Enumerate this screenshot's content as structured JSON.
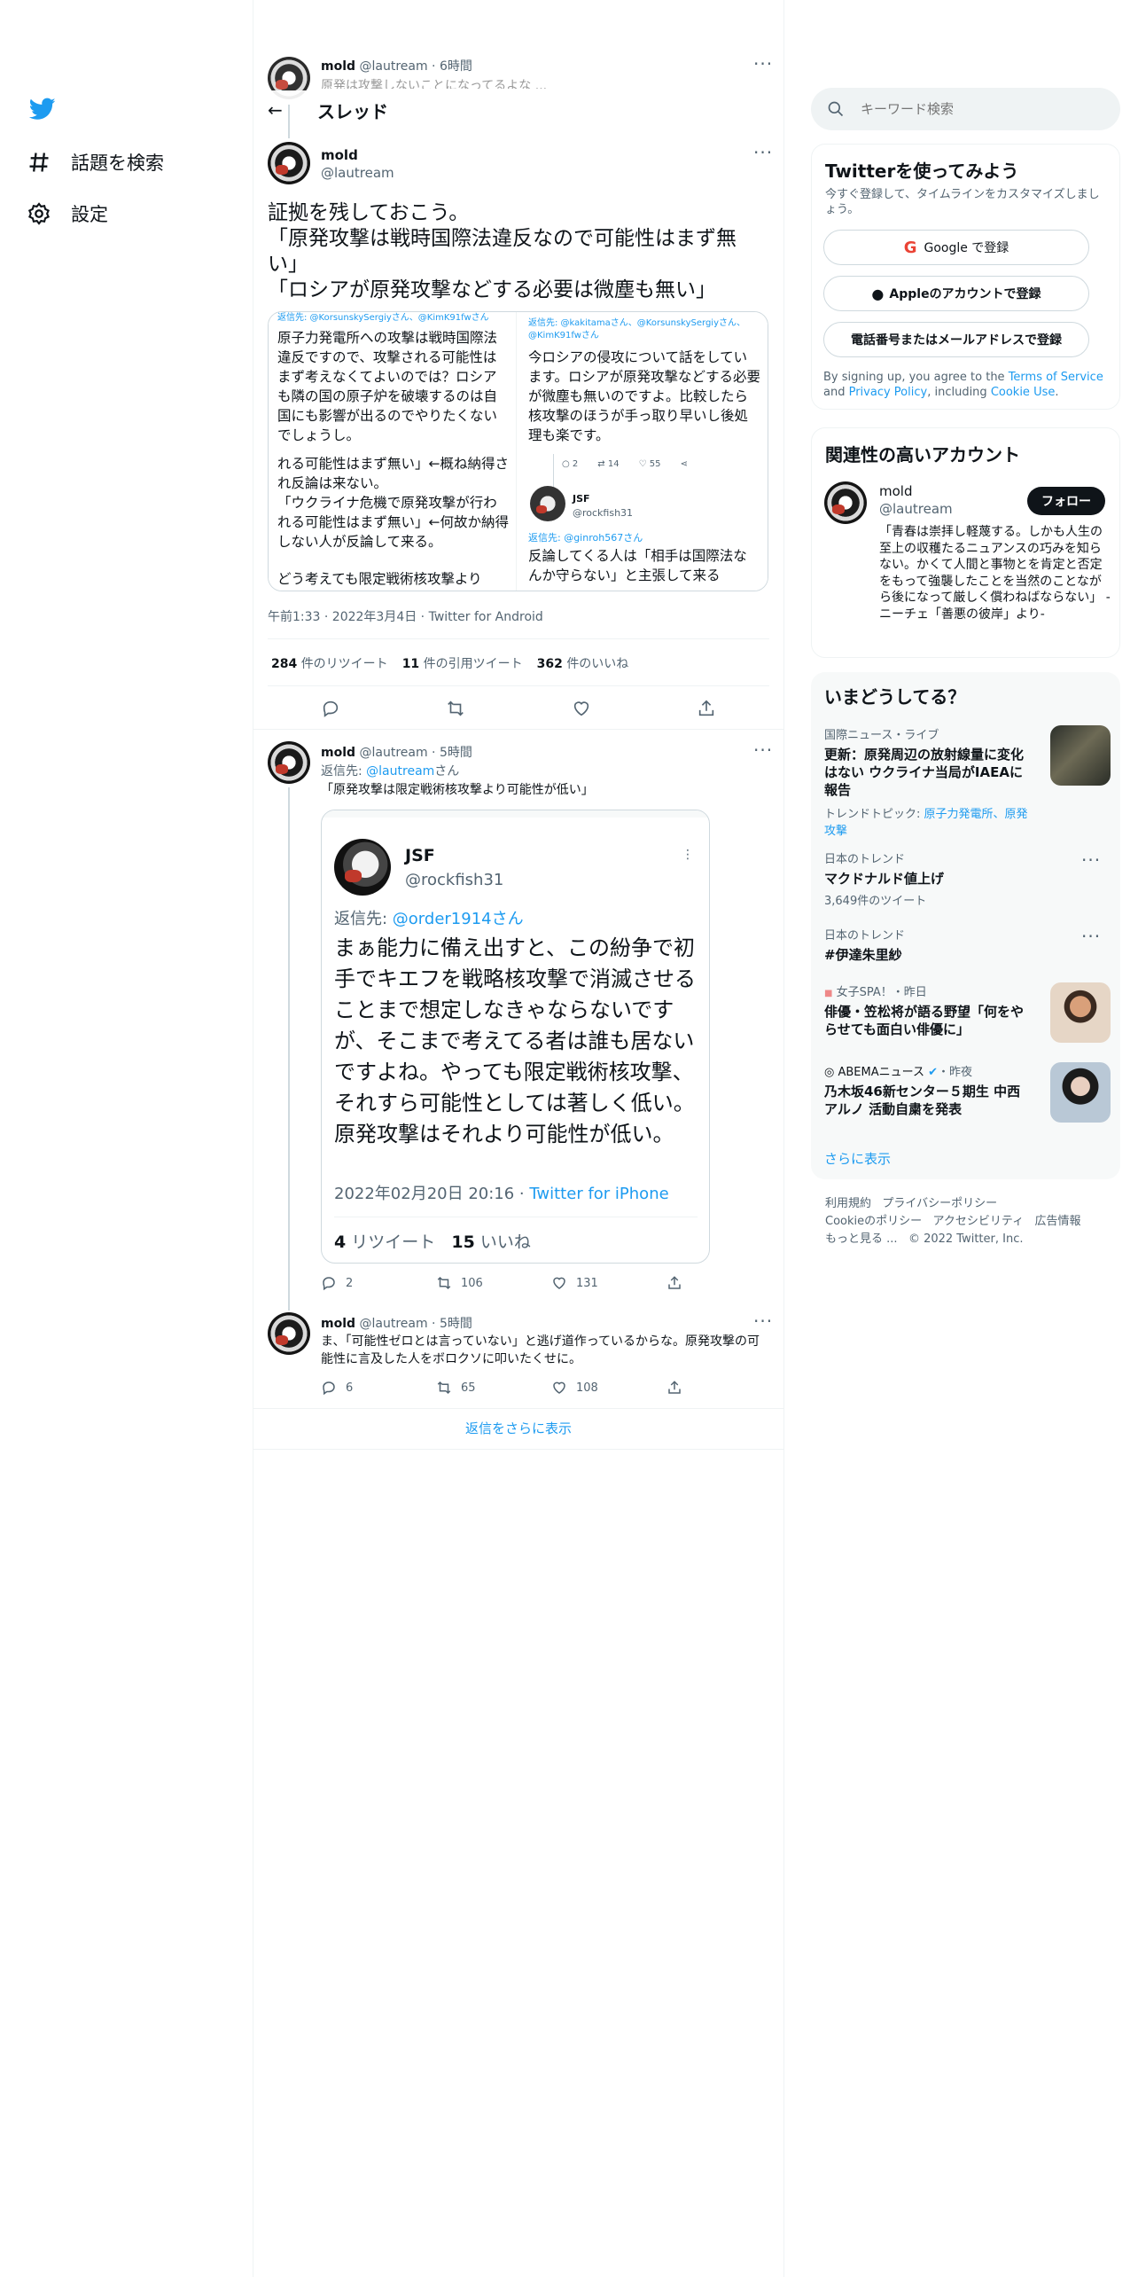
{
  "nav": {
    "explore_label": "話題を検索",
    "settings_label": "設定"
  },
  "header": {
    "title": "スレッド",
    "prev_tweet": {
      "name": "mold",
      "handle": "@lautream",
      "time": "6時間",
      "text": "原発は攻撃しないことになってるよな ... "
    }
  },
  "main_tweet": {
    "name": "mold",
    "handle": "@lautream",
    "text_lines": [
      "証拠を残しておこう。",
      "「原発攻撃は戦時国際法違反なので可能性はまず無",
      "い」",
      "「ロシアが原発攻撃などする必要は微塵も無い」"
    ],
    "image": {
      "left": {
        "reply_to": "返信先: @KorsunskySergiyさん、@KimK91fwさん",
        "body1": "原子力発電所への攻撃は戦時国際法違反ですので、攻撃される可能性はまず考えなくてよいのでは？ロシアも隣の国の原子炉を破壊するのは自国にも影響が出るのでやりたくないでしょうし。",
        "body2": "れる可能性はまず無い」←概ね納得され反論は来ない。",
        "body3": "「ウクライナ危機で原発攻撃が行われる可能性はまず無い」←何故か納得しない人が反論して来る。",
        "body4": "どう考えても限定戦術核攻撃より"
      },
      "right": {
        "reply_to": "返信先: @kakitamaさん、@KorsunskySergiyさん、@KimK91fwさん",
        "body": "今ロシアの侵攻について話をしています。ロシアが原発攻撃などする必要が微塵も無いのですよ。比較したら核攻撃のほうが手っ取り早いし後処理も楽です。",
        "stat_replies": "2",
        "stat_rts": "14",
        "stat_likes": "55",
        "sub_name": "JSF",
        "sub_handle": "@rockfish31",
        "sub_reply_to": "返信先: @ginroh567さん",
        "sub_body": "反論してくる人は「相手は国際法なんか守らない」と主張して来る"
      }
    },
    "timestamp": "午前1:33 · 2022年3月4日 · Twitter for Android",
    "retweets_count": "284",
    "retweets_label": "件のリツイート",
    "quotes_count": "11",
    "quotes_label": "件の引用ツイート",
    "likes_count": "362",
    "likes_label": "件のいいね"
  },
  "reply1": {
    "name": "mold",
    "handle": "@lautream",
    "time": "5時間",
    "reply_prefix": "返信先: ",
    "reply_handle": "@lautream",
    "reply_suffix": "さん",
    "text": "「原発攻撃は限定戦術核攻撃より可能性が低い」",
    "embed": {
      "name": "JSF",
      "handle": "@rockfish31",
      "reply_prefix": "返信先: ",
      "reply_handle": "@order1914さん",
      "body": "まぁ能力に備え出すと、この紛争で初手でキエフを戦略核攻撃で消滅させることまで想定しなきゃならないですが、そこまで考えてる者は誰も居ないですよね。やっても限定戦術核攻撃、それすら可能性としては著しく低い。原発攻撃はそれより可能性が低い。",
      "timestamp": "2022年02月20日 20:16 · ",
      "source": "Twitter for iPhone",
      "rt_count": "4",
      "rt_label": "リツイート",
      "like_count": "15",
      "like_label": "いいね"
    },
    "replies": "2",
    "retweets": "106",
    "likes": "131"
  },
  "reply2": {
    "name": "mold",
    "handle": "@lautream",
    "time": "5時間",
    "text": "ま、「可能性ゼロとは言っていない」と逃げ道作っているからな。原発攻撃の可能性に言及した人をボロクソに叩いたくせに。",
    "replies": "6",
    "retweets": "65",
    "likes": "108"
  },
  "show_more_replies": "返信をさらに表示",
  "search": {
    "placeholder": "キーワード検索"
  },
  "signup": {
    "title": "Twitterを使ってみよう",
    "subtitle": "今すぐ登録して、タイムラインをカスタマイズしましょう。",
    "google_label": "Google で登録",
    "apple_label": "Appleのアカウントで登録",
    "phone_label": "電話番号またはメールアドレスで登録",
    "terms_prefix": "By signing up, you agree to the ",
    "terms_link": "Terms of Service",
    "terms_and": " and ",
    "privacy_link": "Privacy Policy",
    "terms_including": ", including ",
    "cookie_link": "Cookie Use",
    "terms_end": "."
  },
  "related": {
    "title": "関連性の高いアカウント",
    "name": "mold",
    "handle": "@lautream",
    "follow_label": "フォロー",
    "bio": "「青春は崇拝し軽蔑する。しかも人生の至上の収穫たるニュアンスの巧みを知らない。かくて人間と事物とを肯定と否定をもって強襲したことを当然のことながら後になって厳しく償わねばならない」 -ニーチェ「善悪の彼岸」より-"
  },
  "trends": {
    "title": "いまどうしてる？",
    "items": [
      {
        "meta": "国際ニュース・ライブ",
        "title": "更新：原発周辺の放射線量に変化はない ウクライナ当局がIAEAに報告",
        "topic_prefix": "トレンドトピック: ",
        "topic_links": "原子力発電所、原発攻撃"
      },
      {
        "meta": "日本のトレンド",
        "title": "マクドナルド値上げ",
        "count": "3,649件のツイート"
      },
      {
        "meta": "日本のトレンド",
        "title": "#伊達朱里紗"
      },
      {
        "meta": "女子SPA！・昨日",
        "title": "俳優・笠松将が語る野望「何をやらせても面白い俳優に」"
      },
      {
        "meta": "ABEMAニュース",
        "meta_time": "・昨夜",
        "title": "乃木坂46新センター５期生 中西アルノ 活動自粛を発表"
      }
    ],
    "show_more": "さらに表示"
  },
  "footer": {
    "terms": "利用規約",
    "privacy": "プライバシーポリシー",
    "cookie": "Cookieのポリシー",
    "accessibility": "アクセシビリティ",
    "ads": "広告情報",
    "more": "もっと見る ...",
    "copyright": "© 2022 Twitter, Inc."
  },
  "colors": {
    "accent": "#1d9bf0",
    "text": "#0f1419",
    "muted": "#536471",
    "border": "#eff3f4",
    "panel": "#f7f9f9"
  }
}
